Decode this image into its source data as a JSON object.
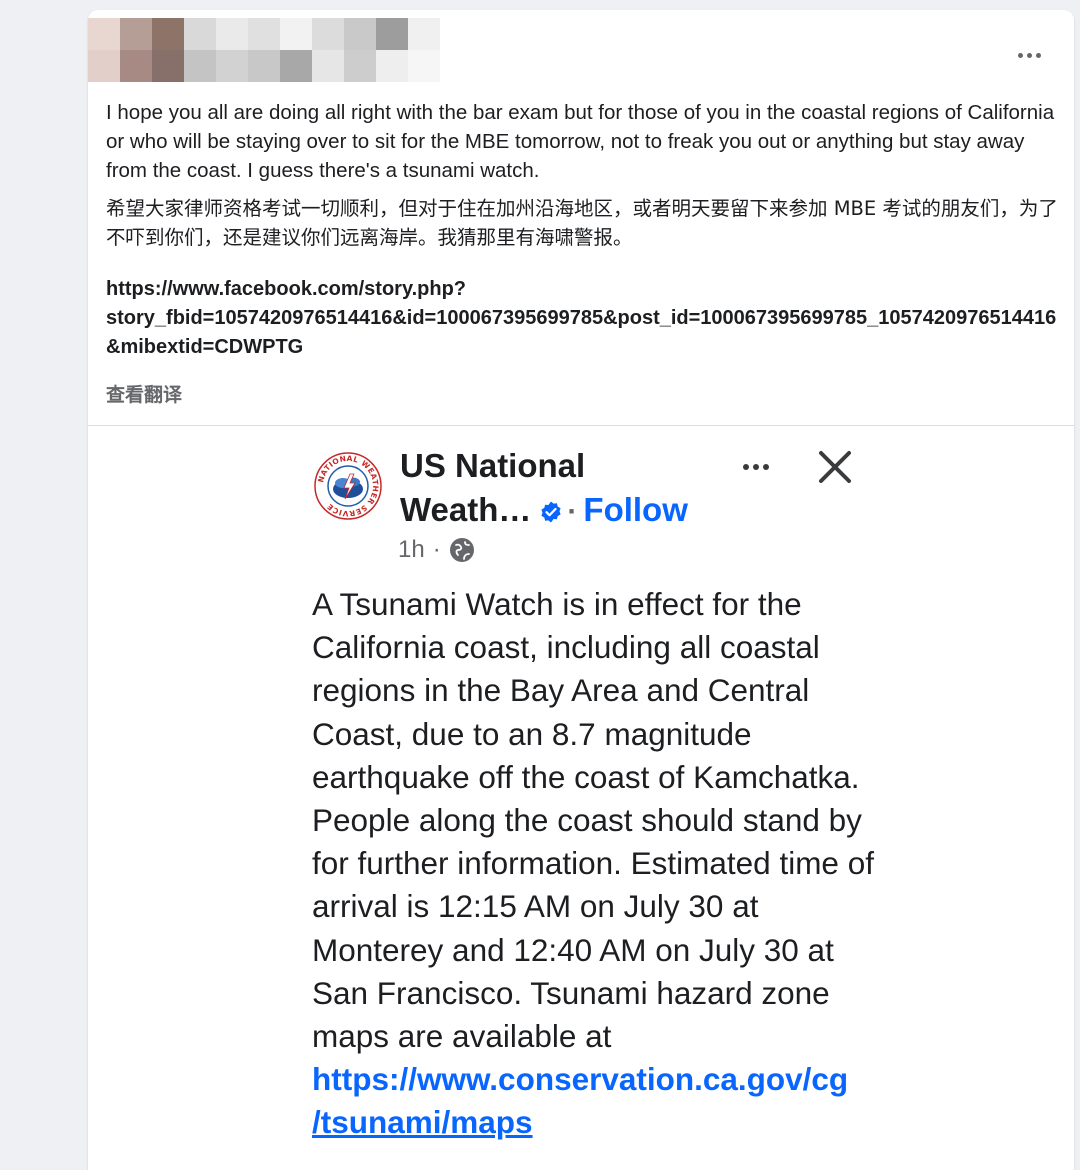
{
  "post": {
    "author_blur_colors": [
      "#e8d6d0",
      "#b59e96",
      "#8e7468",
      "#d9d9d9",
      "#eaeaea",
      "#e0e0e0",
      "#f2f2f2",
      "#dcdcdc",
      "#c9c9c9",
      "#9d9d9d",
      "#f0f0f0",
      "#e2cfc9",
      "#a88a84",
      "#88706a",
      "#c4c4c4",
      "#d2d2d2",
      "#c8c8c8",
      "#a8a8a8",
      "#e6e6e6",
      "#cdcdcd",
      "#eeeeee",
      "#f6f6f6"
    ],
    "paragraph_en": "I hope you all are doing all right with the bar exam but for those of you in the coastal regions of California or who will be staying over to sit for the MBE tomorrow, not to freak you out or anything but stay away from the coast. I guess there's a tsunami watch.",
    "paragraph_zh": "希望大家律师资格考试一切顺利，但对于住在加州沿海地区，或者明天要留下来参加 MBE 考试的朋友们，为了不吓到你们，还是建议你们远离海岸。我猜那里有海啸警报。",
    "link_line1": "https://www.facebook.com/story.php?",
    "link_line2": "story_fbid=1057420976514416&id=100067395699785&post_id=100067395699785_1057420976514416&mibextid=CDWPTG",
    "translate_label": "查看翻译"
  },
  "embedded": {
    "page_name_line1": "US National",
    "page_name_line2": "Weath…",
    "separator": "·",
    "follow_label": "Follow",
    "time": "1h",
    "meta_dot": "·",
    "logo_text": "NATIONAL WEATHER SERVICE",
    "body": "A Tsunami Watch is in effect for the California coast, including all coastal regions in the Bay Area and Central Coast, due to an 8.7 magnitude earthquake off the coast of Kamchatka. People along the coast should stand by for further information. Estimated time of arrival is 12:15 AM on July 30 at Monterey and 12:40 AM on July 30 at San Francisco. Tsunami hazard zone maps are available at",
    "link_line1": "https://www.conservation.ca.gov/cg",
    "link_line2": "/tsunami/maps"
  },
  "colors": {
    "link_blue": "#0866ff",
    "secondary_text": "#65676b",
    "card_bg": "#ffffff",
    "page_bg": "#eef0f3"
  },
  "icons": [
    "more-horizontal-icon",
    "nws-logo",
    "verified-badge-icon",
    "close-icon",
    "globe-icon"
  ]
}
